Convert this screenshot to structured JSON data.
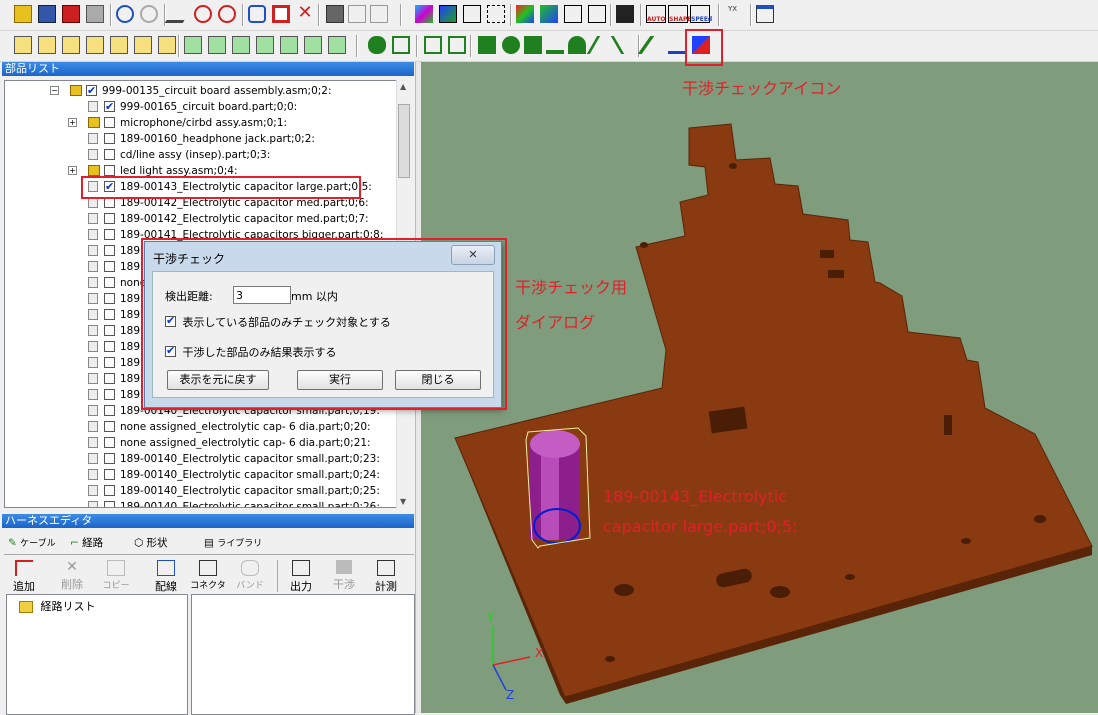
{
  "parts_panel": {
    "title": "部品リスト",
    "rows": [
      {
        "label": "999-00135_circuit  board assembly.asm;0;2:",
        "kind": "asm",
        "checked": true,
        "indent": 0,
        "expander": "−"
      },
      {
        "label": "999-00165_circuit board.part;0;0:",
        "kind": "part",
        "checked": true,
        "indent": 1,
        "expander": ""
      },
      {
        "label": "microphone/cirbd assy.asm;0;1:",
        "kind": "asm",
        "checked": false,
        "indent": 1,
        "expander": "+"
      },
      {
        "label": "189-00160_headphone jack.part;0;2:",
        "kind": "part",
        "checked": false,
        "indent": 1,
        "expander": ""
      },
      {
        "label": "cd/line assy  (insep).part;0;3:",
        "kind": "part",
        "checked": false,
        "indent": 1,
        "expander": ""
      },
      {
        "label": "led light assy.asm;0;4:",
        "kind": "asm",
        "checked": false,
        "indent": 1,
        "expander": "+"
      },
      {
        "label": "189-00143_Electrolytic capacitor large.part;0;5:",
        "kind": "part",
        "checked": true,
        "indent": 1,
        "expander": ""
      },
      {
        "label": "189-00142_Electrolytic capacitor med.part;0;6:",
        "kind": "part",
        "checked": false,
        "indent": 1,
        "expander": ""
      },
      {
        "label": "189-00142_Electrolytic capacitor med.part;0;7:",
        "kind": "part",
        "checked": false,
        "indent": 1,
        "expander": ""
      },
      {
        "label": "189-00141_Electrolytic capacitors bigger.part;0;8:",
        "kind": "part",
        "checked": false,
        "indent": 1,
        "expander": ""
      },
      {
        "label": "189",
        "kind": "part",
        "checked": false,
        "indent": 1,
        "expander": ""
      },
      {
        "label": "189",
        "kind": "part",
        "checked": false,
        "indent": 1,
        "expander": ""
      },
      {
        "label": "none",
        "kind": "part",
        "checked": false,
        "indent": 1,
        "expander": ""
      },
      {
        "label": "189",
        "kind": "part",
        "checked": false,
        "indent": 1,
        "expander": ""
      },
      {
        "label": "189",
        "kind": "part",
        "checked": false,
        "indent": 1,
        "expander": ""
      },
      {
        "label": "189",
        "kind": "part",
        "checked": false,
        "indent": 1,
        "expander": ""
      },
      {
        "label": "189",
        "kind": "part",
        "checked": false,
        "indent": 1,
        "expander": ""
      },
      {
        "label": "189",
        "kind": "part",
        "checked": false,
        "indent": 1,
        "expander": ""
      },
      {
        "label": "189",
        "kind": "part",
        "checked": false,
        "indent": 1,
        "expander": ""
      },
      {
        "label": "189",
        "kind": "part",
        "checked": false,
        "indent": 1,
        "expander": ""
      },
      {
        "label": "189-00140_Electrolytic capacitor small.part;0;19:",
        "kind": "part",
        "checked": false,
        "indent": 1,
        "expander": ""
      },
      {
        "label": "none assigned_electrolytic  cap- 6 dia.part;0;20:",
        "kind": "part",
        "checked": false,
        "indent": 1,
        "expander": ""
      },
      {
        "label": "none assigned_electrolytic  cap- 6 dia.part;0;21:",
        "kind": "part",
        "checked": false,
        "indent": 1,
        "expander": ""
      },
      {
        "label": "189-00140_Electrolytic capacitor small.part;0;23:",
        "kind": "part",
        "checked": false,
        "indent": 1,
        "expander": ""
      },
      {
        "label": "189-00140_Electrolytic capacitor small.part;0;24:",
        "kind": "part",
        "checked": false,
        "indent": 1,
        "expander": ""
      },
      {
        "label": "189-00140_Electrolytic capacitor small.part;0;25:",
        "kind": "part",
        "checked": false,
        "indent": 1,
        "expander": ""
      },
      {
        "label": "189-00140_Electrolytic capacitor small.part;0;26:",
        "kind": "part",
        "checked": false,
        "indent": 1,
        "expander": ""
      }
    ]
  },
  "harness_panel": {
    "title": "ハーネスエディタ",
    "tabs": [
      "ケーブル",
      "経路",
      "形状",
      "ライブラリ"
    ],
    "buttons": [
      "追加",
      "削除",
      "コピー",
      "配線",
      "コネクタ",
      "バンド",
      "出力",
      "干渉",
      "計測"
    ],
    "tree_root": "経路リスト"
  },
  "dialog": {
    "title": "干渉チェック",
    "distance_label": "検出距離:",
    "distance_value": "3",
    "unit_label": "mm 以内",
    "option1": "表示している部品のみチェック対象とする",
    "option2": "干渉した部品のみ結果表示する",
    "btn_restore": "表示を元に戻す",
    "btn_run": "実行",
    "btn_close": "閉じる",
    "close_glyph": "✕"
  },
  "annotations": {
    "icon_note": "干渉チェックアイコン",
    "dialog_note_line1": "干渉チェック用",
    "dialog_note_line2": "ダイアログ",
    "part_note_line1": "189-00143_Electrolytic",
    "part_note_line2": "capacitor large.part;0;5:"
  },
  "toolbar_labels": {
    "auto": "AUTO",
    "shape": "SHAPE",
    "speed": "SPEEd",
    "yx": "YX"
  },
  "axis_labels": {
    "x": "X",
    "y": "Y",
    "z": "Z"
  },
  "colors": {
    "board": "#8a3a10",
    "board_edge": "#5a2408",
    "viewport": "#7f9c7c",
    "capacitor": "#9c2a9c",
    "highlight": "#e0202a"
  }
}
